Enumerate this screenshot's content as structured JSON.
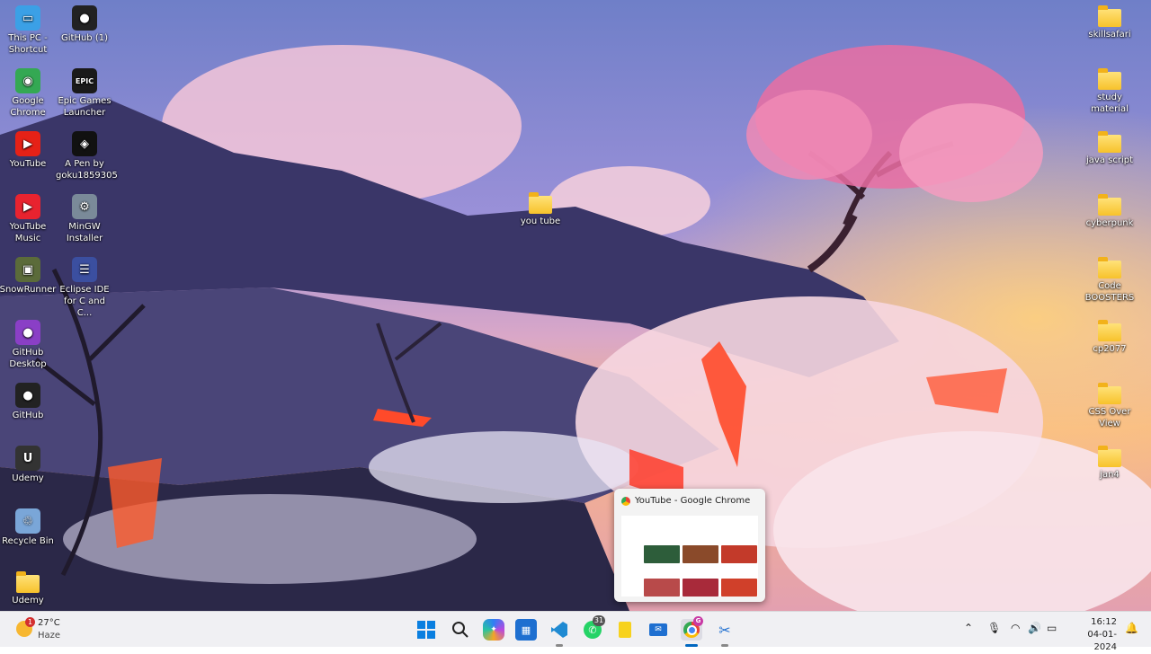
{
  "desktop": {
    "left_icons": [
      {
        "name": "this-pc-shortcut-icon",
        "label": "This PC - Shortcut",
        "glyph": "▭",
        "color": "#3ba0e6"
      },
      {
        "name": "github-1-icon",
        "label": "GitHub (1)",
        "glyph": "●",
        "color": "#222222"
      },
      {
        "name": "google-chrome-icon",
        "label": "Google Chrome",
        "glyph": "◉",
        "color": "#34a853"
      },
      {
        "name": "epic-games-launcher-icon",
        "label": "Epic Games Launcher",
        "glyph": "EPIC",
        "color": "#1a1a1a"
      },
      {
        "name": "youtube-icon",
        "label": "YouTube",
        "glyph": "▶",
        "color": "#e62117"
      },
      {
        "name": "codepen-icon",
        "label": "A Pen by goku1859305",
        "glyph": "◈",
        "color": "#111111"
      },
      {
        "name": "youtube-music-icon",
        "label": "YouTube Music",
        "glyph": "▶",
        "color": "#e8232f"
      },
      {
        "name": "mingw-installer-icon",
        "label": "MinGW Installer",
        "glyph": "⚙",
        "color": "#7a8a99"
      },
      {
        "name": "snowrunner-icon",
        "label": "SnowRunner",
        "glyph": "▣",
        "color": "#5b6b3a"
      },
      {
        "name": "eclipse-ide-icon",
        "label": "Eclipse IDE for C and C...",
        "glyph": "☰",
        "color": "#3b4fa0"
      },
      {
        "name": "github-desktop-icon",
        "label": "GitHub Desktop",
        "glyph": "●",
        "color": "#8a3fc6"
      },
      {
        "name": "github-icon",
        "label": "GitHub",
        "glyph": "●",
        "color": "#222222"
      },
      {
        "name": "udemy-icon",
        "label": "Udemy",
        "glyph": "U",
        "color": "#333333"
      },
      {
        "name": "recycle-bin-icon",
        "label": "Recycle Bin",
        "glyph": "♲",
        "color": "#7aa6d8"
      },
      {
        "name": "udemy-folder-icon",
        "label": "Udemy",
        "glyph": "",
        "color": "folder"
      }
    ],
    "center_icons": [
      {
        "name": "you-tube-folder-icon",
        "label": "you tube"
      }
    ],
    "right_icons": [
      {
        "name": "skillsafari-folder-icon",
        "label": "skillsafari"
      },
      {
        "name": "study-material-folder-icon",
        "label": "study material"
      },
      {
        "name": "java-script-folder-icon",
        "label": "java script"
      },
      {
        "name": "cyberpunk-folder-icon",
        "label": "cyberpunk"
      },
      {
        "name": "code-boosters-folder-icon",
        "label": "Code BOOSTERS"
      },
      {
        "name": "cp2077-icon",
        "label": "cp2077"
      },
      {
        "name": "css-over-view-folder-icon",
        "label": "CSS Over View"
      },
      {
        "name": "jan4-folder-icon",
        "label": "jan4"
      }
    ]
  },
  "preview": {
    "title": "YouTube - Google Chrome"
  },
  "taskbar": {
    "weather": {
      "temp": "27°C",
      "condition": "Haze",
      "badge": "1"
    },
    "chrome_badge": "G",
    "whatsapp_badge": "31",
    "clock": {
      "time": "16:12",
      "date": "04-01-2024"
    },
    "colors": {
      "accent": "#0067c0",
      "bg": "#f0f0f3"
    }
  }
}
